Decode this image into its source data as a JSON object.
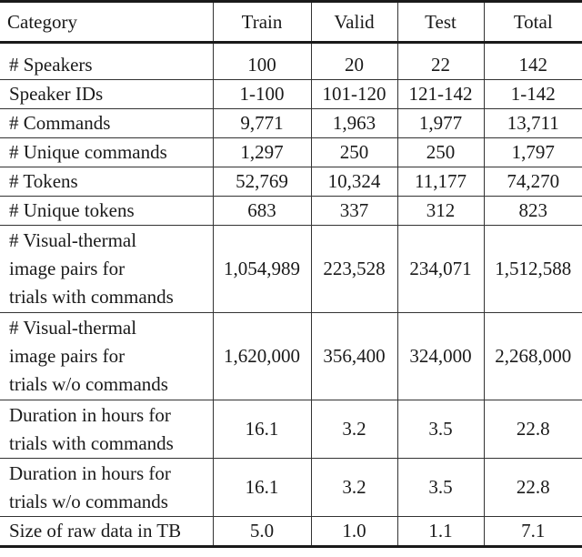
{
  "table": {
    "headers": [
      "Category",
      "Train",
      "Valid",
      "Test",
      "Total"
    ],
    "rows": [
      {
        "category": "# Speakers",
        "train": "100",
        "valid": "20",
        "test": "22",
        "total": "142"
      },
      {
        "category": "Speaker IDs",
        "train": "1-100",
        "valid": "101-120",
        "test": "121-142",
        "total": "1-142"
      },
      {
        "category": "# Commands",
        "train": "9,771",
        "valid": "1,963",
        "test": "1,977",
        "total": "13,711"
      },
      {
        "category": "# Unique commands",
        "train": "1,297",
        "valid": "250",
        "test": "250",
        "total": "1,797"
      },
      {
        "category": "# Tokens",
        "train": "52,769",
        "valid": "10,324",
        "test": "11,177",
        "total": "74,270"
      },
      {
        "category": "# Unique tokens",
        "train": "683",
        "valid": "337",
        "test": "312",
        "total": "823"
      },
      {
        "category": "# Visual-thermal\nimage pairs for\ntrials with commands",
        "train": "1,054,989",
        "valid": "223,528",
        "test": "234,071",
        "total": "1,512,588"
      },
      {
        "category": "# Visual-thermal\nimage pairs for\ntrials w/o commands",
        "train": "1,620,000",
        "valid": "356,400",
        "test": "324,000",
        "total": "2,268,000"
      },
      {
        "category": "Duration in hours for\ntrials with commands",
        "train": "16.1",
        "valid": "3.2",
        "test": "3.5",
        "total": "22.8"
      },
      {
        "category": "Duration in hours for\ntrials w/o commands",
        "train": "16.1",
        "valid": "3.2",
        "test": "3.5",
        "total": "22.8"
      },
      {
        "category": "Size of raw data in TB",
        "train": "5.0",
        "valid": "1.0",
        "test": "1.1",
        "total": "7.1"
      }
    ]
  }
}
